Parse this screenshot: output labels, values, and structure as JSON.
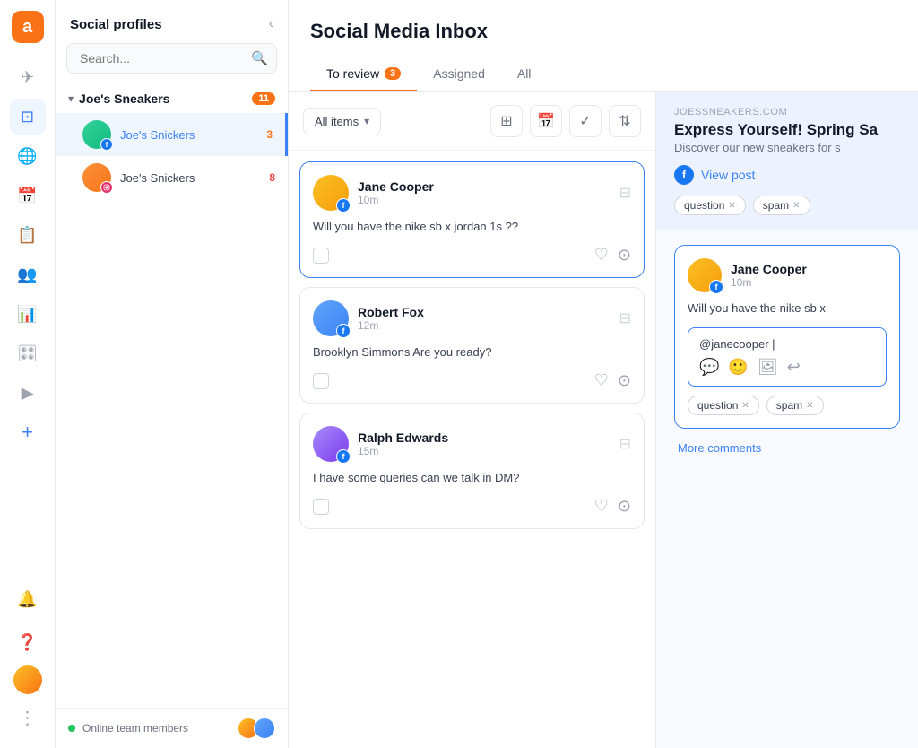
{
  "app": {
    "logo": "a",
    "title": "Social Media Inbox"
  },
  "sidebar": {
    "title": "Social profiles",
    "search_placeholder": "Search...",
    "group": {
      "name": "Joe's Sneakers",
      "badge": "11"
    },
    "items": [
      {
        "name": "Joe's Snickers",
        "count": "3",
        "platform": "fb",
        "active": true
      },
      {
        "name": "Joe's Snickers",
        "count": "8",
        "platform": "instagram",
        "active": false
      }
    ],
    "online_label": "Online team members"
  },
  "tabs": [
    {
      "label": "To review",
      "badge": "3",
      "active": true
    },
    {
      "label": "Assigned",
      "badge": "",
      "active": false
    },
    {
      "label": "All",
      "badge": "",
      "active": false
    }
  ],
  "filter": {
    "label": "All items"
  },
  "messages": [
    {
      "name": "Jane Cooper",
      "time": "10m",
      "text": "Will you have the nike sb x jordan 1s ??",
      "active": true
    },
    {
      "name": "Robert Fox",
      "time": "12m",
      "text": "Brooklyn Simmons Are you ready?",
      "active": false
    },
    {
      "name": "Ralph Edwards",
      "time": "15m",
      "text": "I have some queries can we talk in DM?",
      "active": false
    }
  ],
  "right_panel": {
    "source": "JOESSNEAKERS.COM",
    "title": "Express Yourself! Spring Sa",
    "subtitle": "Discover our new sneakers for s",
    "view_post": "View post",
    "tags": [
      "question",
      "spam"
    ],
    "comment": {
      "name": "Jane Cooper",
      "time": "10m",
      "text": "Will you have the nike sb x",
      "reply_placeholder": "@janecooper |"
    },
    "comment_tags": [
      "question",
      "spam"
    ],
    "more_comments": "More comments"
  }
}
